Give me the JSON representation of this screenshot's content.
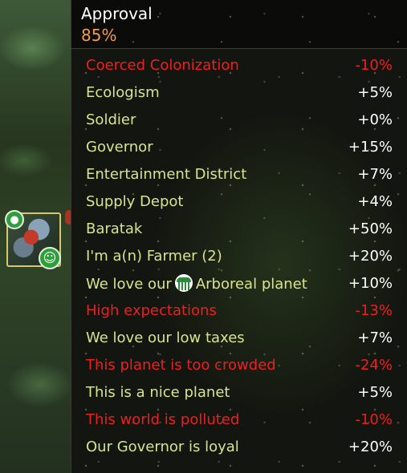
{
  "tooltip": {
    "title": "Approval",
    "value": "85%"
  },
  "rows": [
    {
      "label": "Coerced Colonization",
      "amount": "-10%",
      "type": "negative"
    },
    {
      "label": "Ecologism",
      "amount": "+5%",
      "type": "positive"
    },
    {
      "label": "Soldier",
      "amount": "+0%",
      "type": "positive"
    },
    {
      "label": "Governor",
      "amount": "+15%",
      "type": "positive"
    },
    {
      "label": "Entertainment District",
      "amount": "+7%",
      "type": "positive"
    },
    {
      "label": "Supply Depot",
      "amount": "+4%",
      "type": "positive"
    },
    {
      "label": "Baratak",
      "amount": "+50%",
      "type": "positive"
    },
    {
      "label": "I'm a(n) Farmer (2)",
      "amount": "+20%",
      "type": "positive"
    },
    {
      "label_before": "We love our",
      "label_after": "Arboreal planet",
      "icon": "arboreal-planet-icon",
      "amount": "+10%",
      "type": "positive"
    },
    {
      "label": "High expectations",
      "amount": "-13%",
      "type": "negative"
    },
    {
      "label": "We love our low taxes",
      "amount": "+7%",
      "type": "positive"
    },
    {
      "label": "This planet is too crowded",
      "amount": "-24%",
      "type": "negative"
    },
    {
      "label": "This is a nice planet",
      "amount": "+5%",
      "type": "positive"
    },
    {
      "label": "This world is polluted",
      "amount": "-10%",
      "type": "negative"
    },
    {
      "label": "Our Governor is loyal",
      "amount": "+20%",
      "type": "positive"
    }
  ],
  "colors": {
    "positive_label": "#d8e38a",
    "positive_amount": "#ffffff",
    "negative": "#ee1f1f",
    "approval_value": "#f29b4c"
  },
  "portrait": {
    "badge_top_icon": "apple-icon",
    "badge_bottom_icon": "smiley-icon"
  }
}
